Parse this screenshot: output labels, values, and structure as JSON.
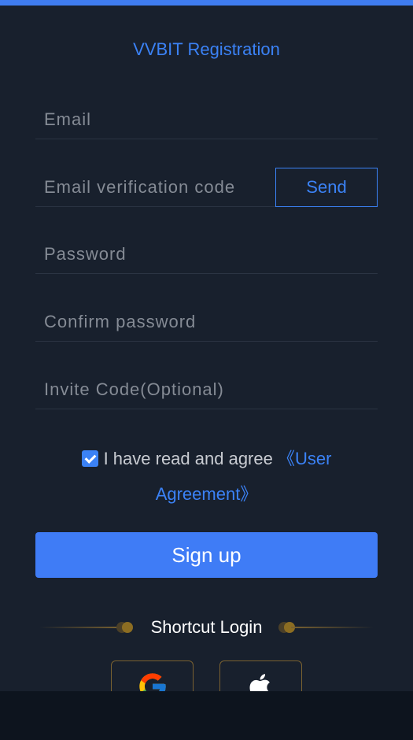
{
  "header": {
    "title": "VVBIT Registration"
  },
  "form": {
    "email": {
      "placeholder": "Email",
      "value": ""
    },
    "verification": {
      "placeholder": "Email verification code",
      "value": "",
      "send_label": "Send"
    },
    "password": {
      "placeholder": "Password",
      "value": ""
    },
    "confirm_password": {
      "placeholder": "Confirm password",
      "value": ""
    },
    "invite_code": {
      "placeholder": "Invite Code(Optional)",
      "value": ""
    },
    "agreement": {
      "checked": true,
      "text": "I have read and agree ",
      "link": "《User Agreement》"
    },
    "submit_label": "Sign up"
  },
  "shortcut": {
    "label": "Shortcut Login",
    "providers": [
      {
        "name": "google",
        "icon": "google-icon"
      },
      {
        "name": "apple",
        "icon": "apple-icon"
      }
    ]
  },
  "colors": {
    "background": "#18202d",
    "accent": "#3b82f6",
    "button": "#3f7cf6",
    "gold": "#7a6230",
    "bottom_bar": "#0d141e"
  }
}
